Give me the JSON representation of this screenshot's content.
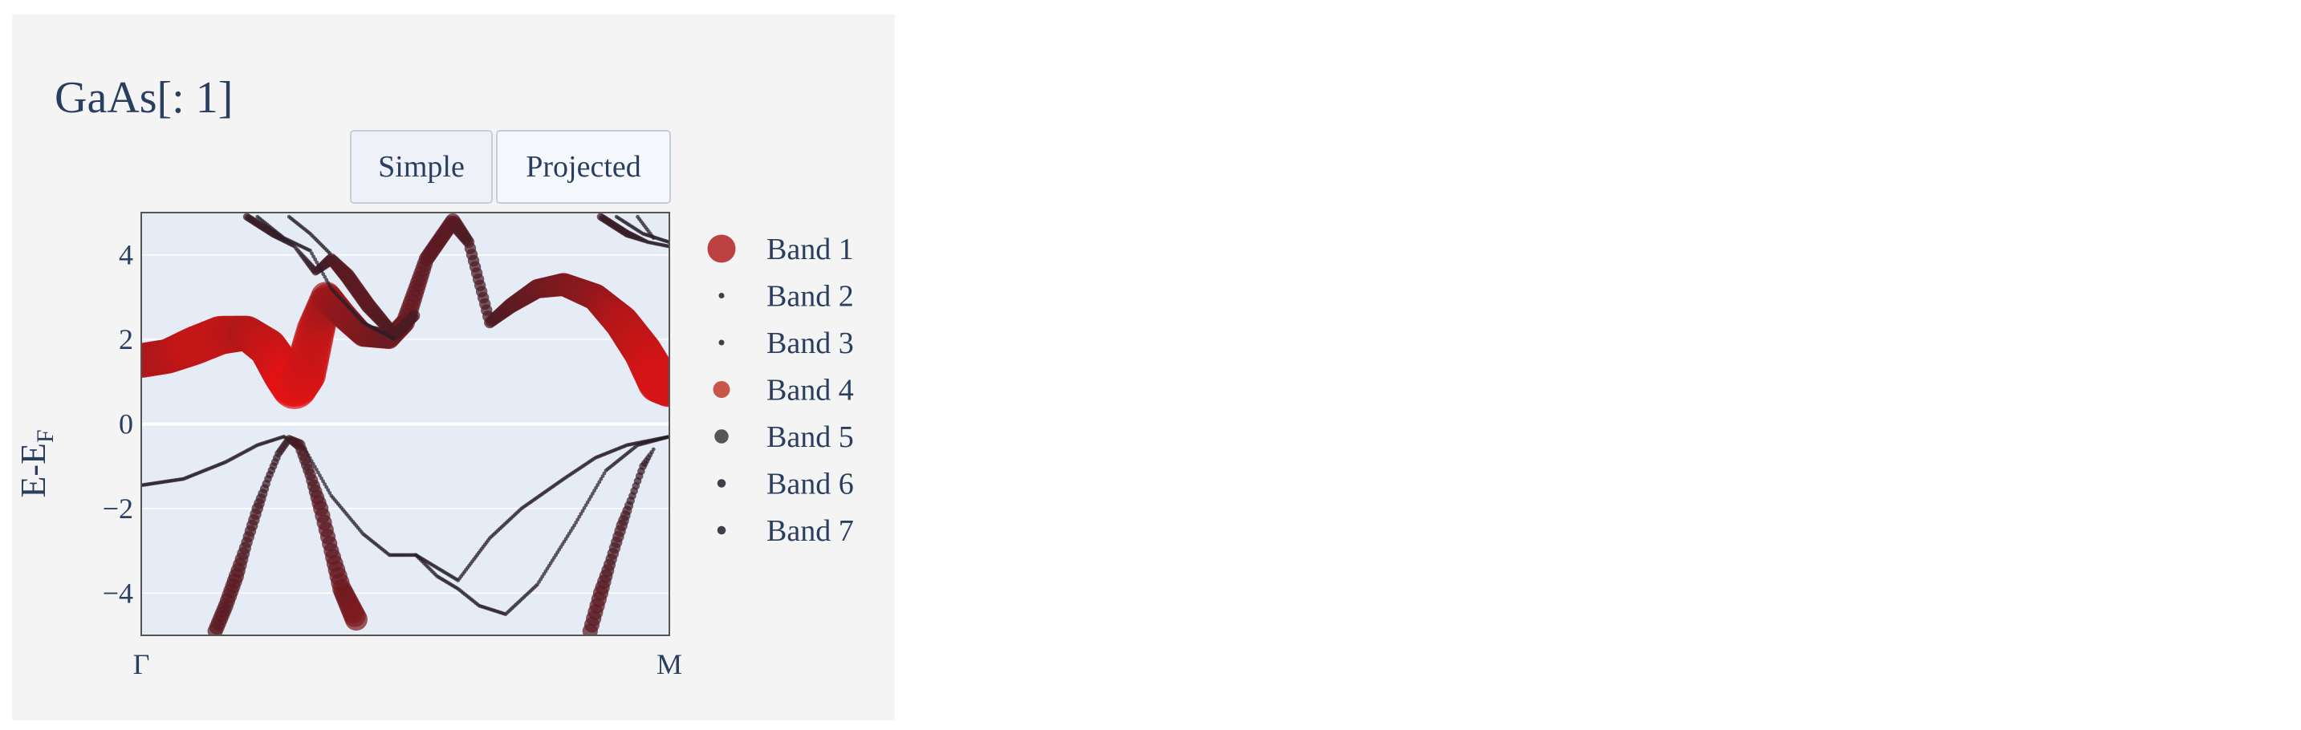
{
  "title": "GaAs[: 1]",
  "buttons": {
    "simple": "Simple",
    "projected": "Projected"
  },
  "colors": {
    "plot_bg": "#e5ecf6",
    "panel_bg": "#f4f4f4",
    "text": "#2a3f5f",
    "projected": "#c00000",
    "line": "#1e1e2e"
  },
  "chart_data": {
    "type": "scatter",
    "title": "GaAs[: 1]",
    "xlabel": "",
    "ylabel_main": "E-E",
    "ylabel_sub": "F",
    "xlim": [
      0,
      1
    ],
    "ylim": [
      -5,
      5
    ],
    "yticks": [
      -4,
      -2,
      0,
      2,
      4
    ],
    "ytick_labels": [
      "−4",
      "−2",
      "0",
      "2",
      "4"
    ],
    "xticks": [
      0,
      1
    ],
    "xtick_labels": [
      "Γ",
      "M"
    ],
    "fermi_level": 0,
    "legend_position": "right",
    "series": [
      {
        "name": "Band 1",
        "legend_size": 10,
        "legend_color": "#b22222",
        "points": [
          [
            0,
            1.5,
            9
          ],
          [
            0.05,
            1.6,
            9
          ],
          [
            0.1,
            1.85,
            10
          ],
          [
            0.15,
            2.1,
            10
          ],
          [
            0.2,
            2.15,
            9
          ],
          [
            0.24,
            1.8,
            10
          ],
          [
            0.27,
            1.2,
            11
          ],
          [
            0.29,
            0.9,
            12
          ],
          [
            0.31,
            1.2,
            11
          ],
          [
            0.33,
            2.2,
            10
          ],
          [
            0.35,
            3.0,
            8
          ],
          [
            0.38,
            2.6,
            7
          ],
          [
            0.42,
            2.1,
            6
          ],
          [
            0.47,
            2.0,
            5
          ],
          [
            0.5,
            2.4,
            5
          ],
          [
            0.54,
            3.9,
            4
          ],
          [
            0.59,
            4.8,
            4
          ],
          [
            0.62,
            4.3,
            3
          ],
          [
            0.66,
            2.4,
            3
          ],
          [
            0.7,
            2.8,
            4
          ],
          [
            0.75,
            3.2,
            5
          ],
          [
            0.8,
            3.3,
            6
          ],
          [
            0.86,
            3.0,
            7
          ],
          [
            0.91,
            2.4,
            9
          ],
          [
            0.95,
            1.7,
            10
          ],
          [
            0.98,
            1.0,
            11
          ],
          [
            1.0,
            0.9,
            11
          ]
        ]
      },
      {
        "name": "Band 2",
        "legend_size": 2,
        "legend_color": "#1e1e2e",
        "points": [
          [
            0,
            -1.45,
            1
          ],
          [
            0.08,
            -1.3,
            1
          ],
          [
            0.16,
            -0.9,
            1
          ],
          [
            0.22,
            -0.5,
            1
          ],
          [
            0.27,
            -0.3,
            1
          ],
          [
            0.31,
            -0.6,
            1
          ],
          [
            0.36,
            -1.7,
            1
          ],
          [
            0.42,
            -2.6,
            1
          ],
          [
            0.47,
            -3.1,
            1
          ],
          [
            0.52,
            -3.1,
            1
          ],
          [
            0.56,
            -3.6,
            1
          ],
          [
            0.6,
            -3.9,
            1
          ],
          [
            0.64,
            -4.3,
            1
          ],
          [
            0.69,
            -4.5,
            1
          ],
          [
            0.75,
            -3.8,
            1
          ],
          [
            0.82,
            -2.4,
            1
          ],
          [
            0.88,
            -1.1,
            1
          ],
          [
            0.94,
            -0.5,
            1
          ],
          [
            1.0,
            -0.3,
            1
          ]
        ]
      },
      {
        "name": "Band 3",
        "legend_size": 2,
        "legend_color": "#1e1e2e",
        "points": [
          [
            0.52,
            -3.1,
            1
          ],
          [
            0.56,
            -3.4,
            1
          ],
          [
            0.6,
            -3.7,
            1
          ],
          [
            0.63,
            -3.2,
            1
          ],
          [
            0.66,
            -2.7,
            1
          ],
          [
            0.72,
            -2.0,
            1
          ],
          [
            0.8,
            -1.3,
            1
          ],
          [
            0.86,
            -0.8,
            1
          ],
          [
            0.92,
            -0.5,
            1
          ],
          [
            1.0,
            -0.3,
            1
          ]
        ]
      },
      {
        "name": "Band 4",
        "legend_size": 6,
        "legend_color": "#c0392b",
        "points": [
          [
            0.14,
            -4.9,
            4
          ],
          [
            0.16,
            -4.3,
            4
          ],
          [
            0.18,
            -3.6,
            4
          ],
          [
            0.2,
            -2.8,
            3
          ],
          [
            0.22,
            -2.0,
            3
          ],
          [
            0.24,
            -1.3,
            2
          ],
          [
            0.26,
            -0.7,
            2
          ],
          [
            0.28,
            -0.35,
            2
          ],
          [
            0.3,
            -0.5,
            3
          ],
          [
            0.32,
            -1.2,
            3
          ],
          [
            0.34,
            -2.0,
            4
          ],
          [
            0.36,
            -3.0,
            4
          ],
          [
            0.38,
            -3.9,
            5
          ],
          [
            0.41,
            -4.7,
            6
          ],
          [
            0.85,
            -4.9,
            4
          ],
          [
            0.87,
            -4.0,
            4
          ],
          [
            0.89,
            -3.2,
            3
          ],
          [
            0.91,
            -2.4,
            3
          ],
          [
            0.93,
            -1.7,
            2
          ],
          [
            0.95,
            -1.0,
            2
          ],
          [
            0.97,
            -0.6,
            1
          ]
        ]
      },
      {
        "name": "Band 5",
        "legend_size": 5,
        "legend_color": "#3a3a3a",
        "points": [
          [
            0.2,
            4.9,
            2
          ],
          [
            0.25,
            4.5,
            2
          ],
          [
            0.29,
            4.2,
            1
          ],
          [
            0.33,
            3.6,
            2
          ],
          [
            0.36,
            3.9,
            3
          ],
          [
            0.39,
            3.5,
            4
          ],
          [
            0.43,
            2.8,
            4
          ],
          [
            0.48,
            2.1,
            3
          ],
          [
            0.52,
            2.6,
            3
          ],
          [
            0.87,
            4.9,
            2
          ],
          [
            0.92,
            4.5,
            2
          ],
          [
            0.96,
            4.3,
            1
          ],
          [
            1.0,
            4.2,
            1
          ]
        ]
      },
      {
        "name": "Band 6",
        "legend_size": 3,
        "legend_color": "#1e1e2e",
        "points": [
          [
            0.22,
            4.9,
            1
          ],
          [
            0.27,
            4.4,
            1
          ],
          [
            0.32,
            4.1,
            1
          ],
          [
            0.36,
            3.2,
            1
          ],
          [
            0.42,
            2.4,
            1
          ],
          [
            0.48,
            2.0,
            1
          ],
          [
            0.9,
            4.9,
            1
          ],
          [
            0.95,
            4.5,
            1
          ],
          [
            1.0,
            4.3,
            1
          ]
        ]
      },
      {
        "name": "Band 7",
        "legend_size": 3,
        "legend_color": "#1e1e2e",
        "points": [
          [
            0.28,
            4.9,
            1
          ],
          [
            0.32,
            4.5,
            1
          ],
          [
            0.36,
            4.0,
            1
          ],
          [
            0.94,
            4.9,
            1
          ],
          [
            0.97,
            4.4,
            1
          ]
        ]
      }
    ]
  }
}
